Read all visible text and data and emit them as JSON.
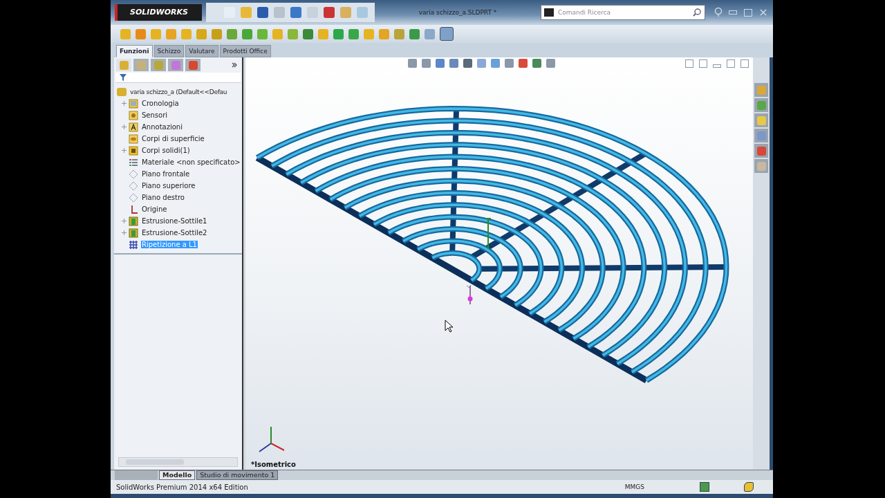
{
  "title_bar": {
    "logo": "SOLIDWORKS",
    "document_title": "varia schizzo_a.SLDPRT *",
    "search": {
      "placeholder": "Comandi Ricerca"
    }
  },
  "command_tabs": [
    {
      "label": "Funzioni",
      "selected": true
    },
    {
      "label": "Schizzo",
      "selected": false
    },
    {
      "label": "Valutare",
      "selected": false
    },
    {
      "label": "Prodotti Office",
      "selected": false
    }
  ],
  "panel_tabs": [
    {
      "selected": true
    },
    {
      "selected": false
    },
    {
      "selected": false
    },
    {
      "selected": false
    },
    {
      "selected": false
    }
  ],
  "feature_tree": {
    "root": "varia schizzo_a  (Default<<Defau",
    "items": [
      {
        "label": "Cronologia",
        "kind": "history",
        "expandable": true,
        "selected": false
      },
      {
        "label": "Sensori",
        "kind": "sensor",
        "expandable": false,
        "selected": false
      },
      {
        "label": "Annotazioni",
        "kind": "annotation",
        "expandable": true,
        "selected": false
      },
      {
        "label": "Corpi di superficie",
        "kind": "surface",
        "expandable": false,
        "selected": false
      },
      {
        "label": "Corpi solidi(1)",
        "kind": "solid",
        "expandable": true,
        "selected": false
      },
      {
        "label": "Materiale <non specificato>",
        "kind": "material",
        "expandable": false,
        "selected": false
      },
      {
        "label": "Piano frontale",
        "kind": "plane",
        "expandable": false,
        "selected": false
      },
      {
        "label": "Piano superiore",
        "kind": "plane",
        "expandable": false,
        "selected": false
      },
      {
        "label": "Piano destro",
        "kind": "plane",
        "expandable": false,
        "selected": false
      },
      {
        "label": "Origine",
        "kind": "origin",
        "expandable": false,
        "selected": false
      },
      {
        "label": "Estrusione-Sottile1",
        "kind": "feature",
        "expandable": true,
        "selected": false
      },
      {
        "label": "Estrusione-Sottile2",
        "kind": "feature",
        "expandable": true,
        "selected": false
      },
      {
        "label": "Ripetizione a L1",
        "kind": "pattern",
        "expandable": false,
        "selected": true
      }
    ]
  },
  "viewport": {
    "view_label": "*Isometrico"
  },
  "bottom_tabs": [
    {
      "label": "Modello",
      "selected": true
    },
    {
      "label": "Studio di movimento 1",
      "selected": false
    }
  ],
  "status_bar": {
    "text": "SolidWorks Premium 2014 x64 Edition",
    "units": "MMGS"
  }
}
